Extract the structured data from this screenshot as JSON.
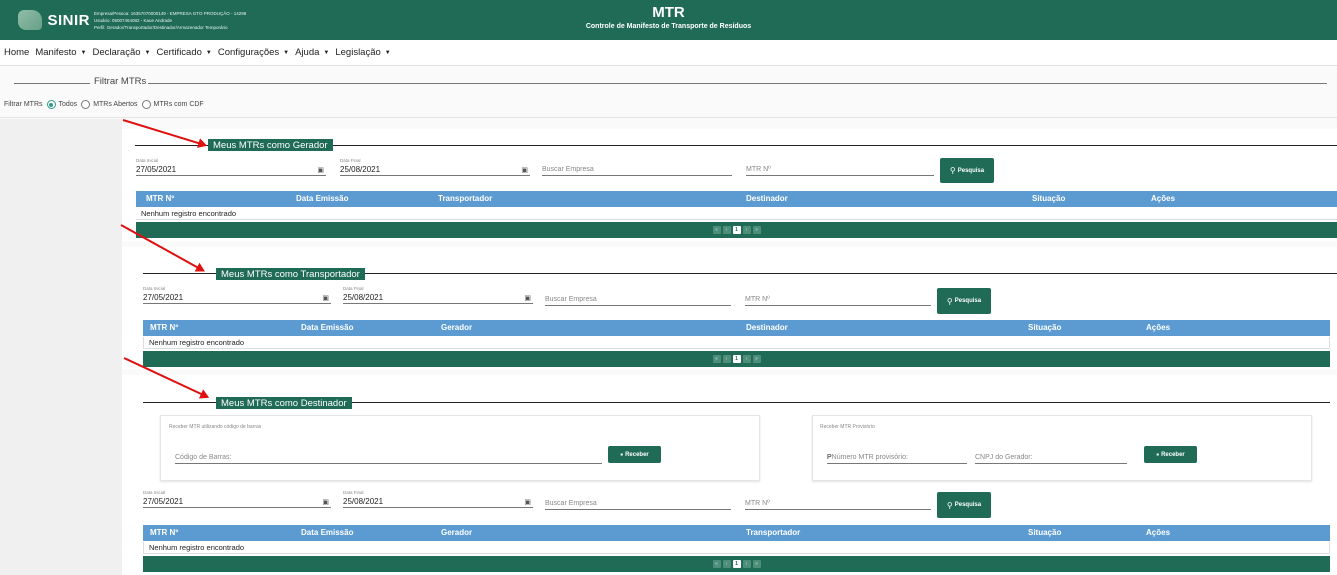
{
  "header": {
    "logo_text": "SINIR",
    "user_lines": [
      "Empresa/Pessoa: 16357070000149 - EMPRESA GTO PRODUÇÃO - 14298",
      "Usuário: 05007464082 - Kaue Andrade",
      "Perfil: Gerador/Transportador/Destinador/Armazenador Temporário"
    ],
    "title": "MTR",
    "subtitle": "Controle de Manifesto de Transporte de Resíduos"
  },
  "menu": {
    "items": [
      {
        "label": "Home",
        "dropdown": false
      },
      {
        "label": "Manifesto",
        "dropdown": true
      },
      {
        "label": "Declaração",
        "dropdown": true
      },
      {
        "label": "Certificado",
        "dropdown": true
      },
      {
        "label": "Configurações",
        "dropdown": true
      },
      {
        "label": "Ajuda",
        "dropdown": true
      },
      {
        "label": "Legislação",
        "dropdown": true
      }
    ]
  },
  "filter": {
    "legend": "Filtrar MTRs",
    "label": "Filtrar MTRs",
    "options": [
      {
        "label": "Todos",
        "checked": true
      },
      {
        "label": "MTRs Abertos",
        "checked": false
      },
      {
        "label": "MTRs com CDF",
        "checked": false
      }
    ]
  },
  "common": {
    "date_start_label": "Data Inicial",
    "date_end_label": "Data Final",
    "date_start": "27/05/2021",
    "date_end": "25/08/2021",
    "search_company_placeholder": "Buscar Empresa",
    "mtr_number_placeholder": "MTR Nº",
    "search_button": "Pesquisa",
    "empty_message": "Nenhum registro encontrado",
    "pagination": [
      "«",
      "‹",
      "1",
      "›",
      "»"
    ]
  },
  "gerador": {
    "legend": "Meus MTRs como Gerador",
    "columns": [
      "MTR Nº",
      "Data Emissão",
      "Transportador",
      "Destinador",
      "Situação",
      "Ações"
    ]
  },
  "transportador": {
    "legend": "Meus MTRs como Transportador",
    "columns": [
      "MTR Nº",
      "Data Emissão",
      "Gerador",
      "Destinador",
      "Situação",
      "Ações"
    ]
  },
  "destinador": {
    "legend": "Meus MTRs como Destinador",
    "barcode_label": "Receber MTR utilizando código de barras",
    "barcode_placeholder": "Código de Barras:",
    "receive_button": "Receber",
    "provisional_label": "Receber MTR Provisório",
    "provisional_prefix": "P",
    "provisional_placeholder": "Número MTR provisório:",
    "cnpj_placeholder": "CNPJ do Gerador:",
    "columns": [
      "MTR Nº",
      "Data Emissão",
      "Gerador",
      "Transportador",
      "Situação",
      "Ações"
    ]
  },
  "colors": {
    "header_green": "#1f6b55",
    "table_head_blue": "#5b9bd1",
    "radio_teal": "#2d9e8a",
    "annotation_red": "#e01010"
  }
}
